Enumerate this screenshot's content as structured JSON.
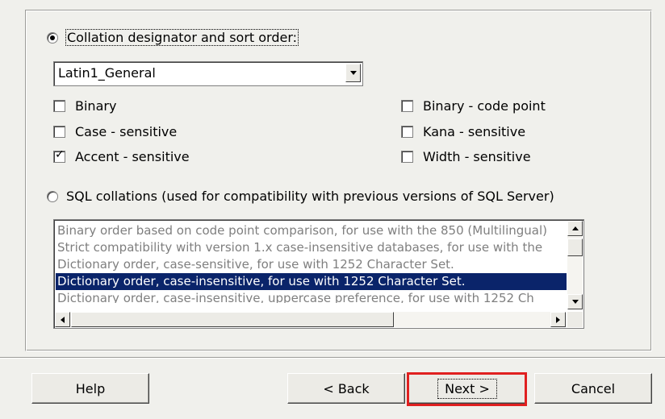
{
  "collation": {
    "designator_radio_label": "Collation designator and sort order:",
    "designator_selected": true,
    "designator_value": "Latin1_General",
    "options": [
      {
        "label": "Binary",
        "checked": false
      },
      {
        "label": "Case - sensitive",
        "checked": false
      },
      {
        "label": "Accent - sensitive",
        "checked": true
      },
      {
        "label": "Binary - code point",
        "checked": false
      },
      {
        "label": "Kana - sensitive",
        "checked": false
      },
      {
        "label": "Width - sensitive",
        "checked": false
      }
    ],
    "sql_radio_label": "SQL collations (used for compatibility with previous versions of SQL Server)",
    "sql_selected": false,
    "sql_list": [
      "Binary order based on code point comparison, for use with the 850 (Multilingual)",
      "Strict compatibility with version 1.x case-insensitive databases, for use with the",
      "Dictionary order, case-sensitive, for use with 1252 Character Set.",
      "Dictionary order, case-insensitive, for use with 1252 Character Set.",
      "Dictionary order, case-insensitive, uppercase preference, for use with 1252 Ch"
    ],
    "sql_list_selected_index": 3
  },
  "buttons": {
    "help": "Help",
    "back": "< Back",
    "next": "Next >",
    "cancel": "Cancel"
  },
  "colors": {
    "selection": "#0a246a",
    "highlight_border": "#e02020",
    "disabled_text": "#7f7f7f"
  }
}
